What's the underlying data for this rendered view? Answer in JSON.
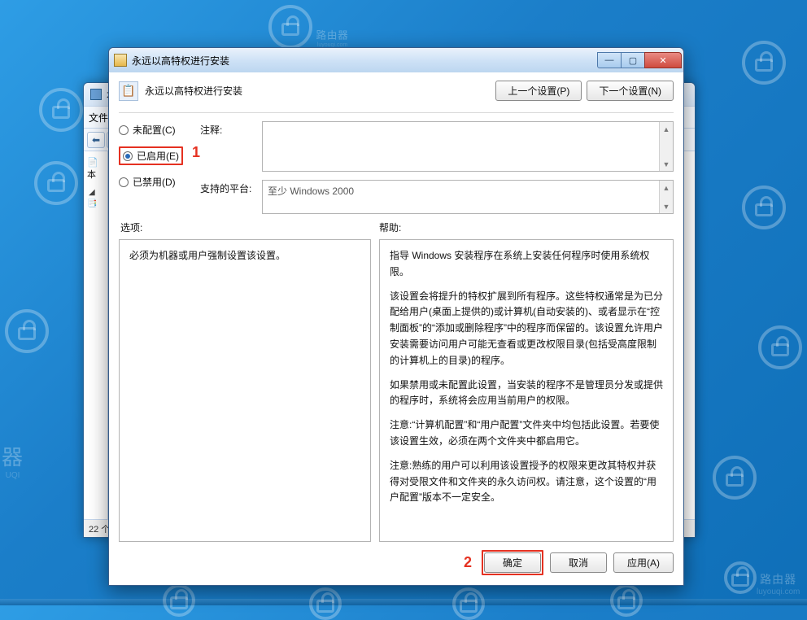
{
  "watermark": {
    "brand": "路由器",
    "sub": "luyouqi.com"
  },
  "back_window": {
    "title_prefix": "本",
    "toolbar_label": "文件",
    "tree_root_prefix": "本",
    "status": "22 个"
  },
  "dialog": {
    "title": "永远以高特权进行安装",
    "heading": "永远以高特权进行安装",
    "prev_btn": "上一个设置(P)",
    "next_btn": "下一个设置(N)",
    "radios": {
      "not_configured": "未配置(C)",
      "enabled": "已启用(E)",
      "disabled": "已禁用(D)"
    },
    "marker1": "1",
    "comment_label": "注释:",
    "platform_label": "支持的平台:",
    "platform_value": "至少 Windows 2000",
    "options_label": "选项:",
    "help_label": "帮助:",
    "options_text": "必须为机器或用户强制设置该设置。",
    "help_p1": "指导 Windows 安装程序在系统上安装任何程序时使用系统权限。",
    "help_p2": "该设置会将提升的特权扩展到所有程序。这些特权通常是为已分配给用户(桌面上提供的)或计算机(自动安装的)、或者显示在“控制面板”的“添加或删除程序”中的程序而保留的。该设置允许用户安装需要访问用户可能无查看或更改权限目录(包括受高度限制的计算机上的目录)的程序。",
    "help_p3": "如果禁用或未配置此设置，当安装的程序不是管理员分发或提供的程序时，系统将会应用当前用户的权限。",
    "help_p4": "注意:“计算机配置”和“用户配置”文件夹中均包括此设置。若要使该设置生效，必须在两个文件夹中都启用它。",
    "help_p5": "注意:熟练的用户可以利用该设置授予的权限来更改其特权并获得对受限文件和文件夹的永久访问权。请注意，这个设置的“用户配置”版本不一定安全。",
    "marker2": "2",
    "ok_btn": "确定",
    "cancel_btn": "取消",
    "apply_btn": "应用(A)"
  }
}
